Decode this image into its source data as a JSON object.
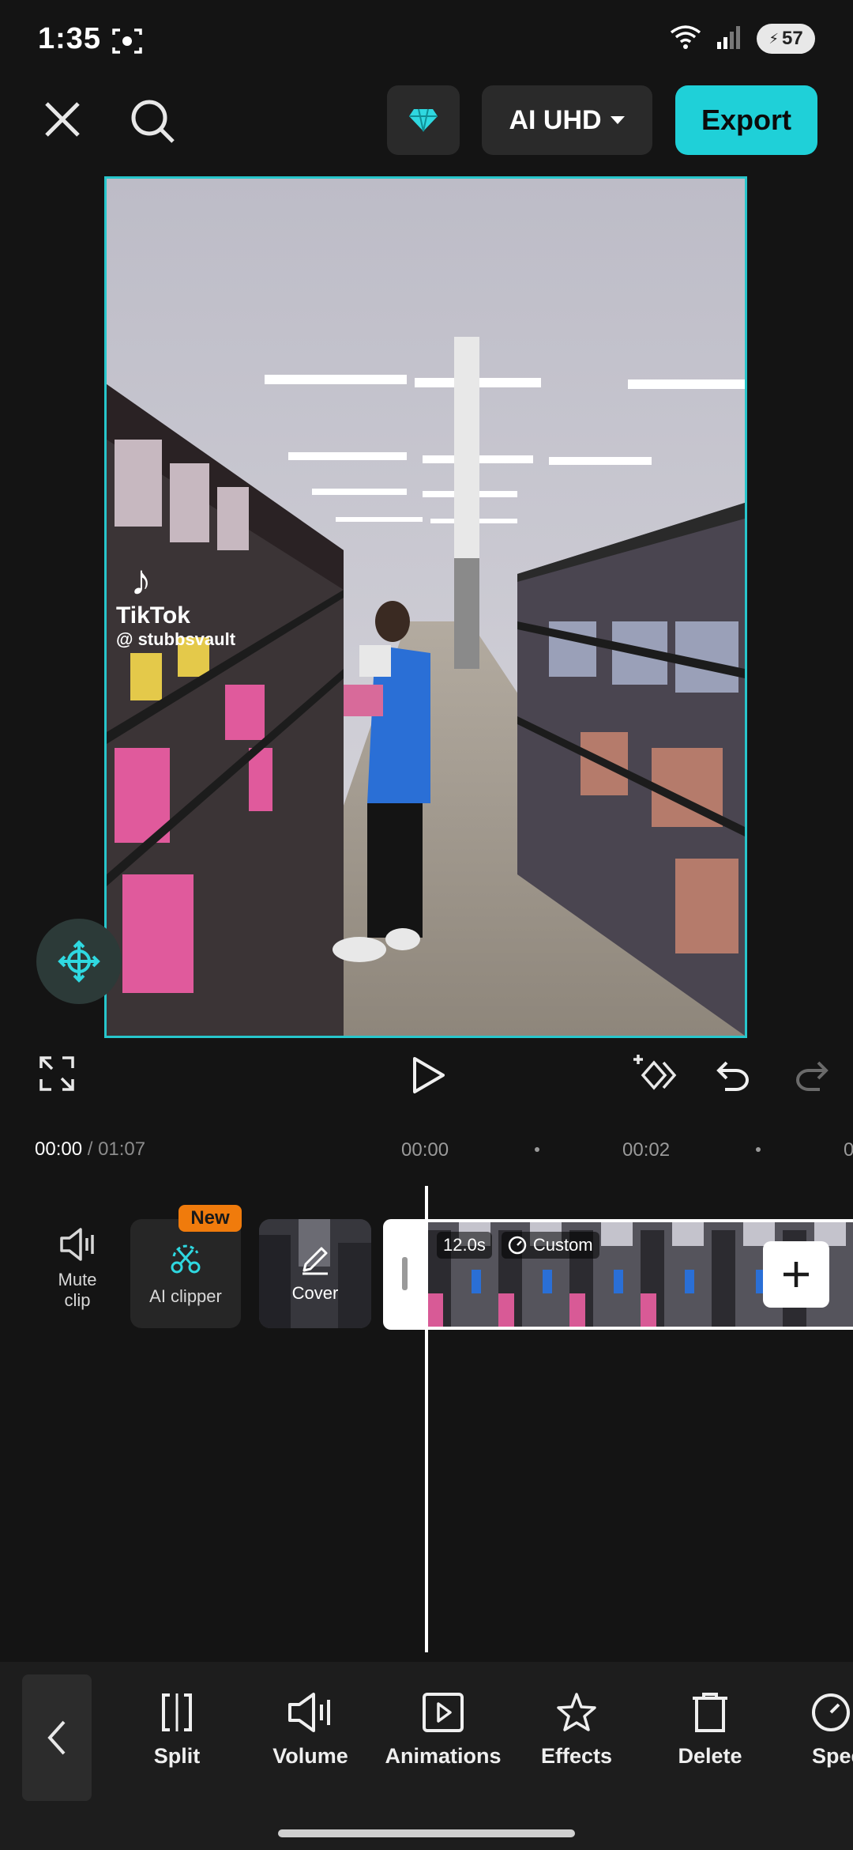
{
  "status": {
    "time": "1:35",
    "battery": "57"
  },
  "topbar": {
    "quality_label": "AI UHD",
    "export_label": "Export"
  },
  "preview": {
    "watermark_brand": "TikTok",
    "watermark_user": "@ stubbsvault"
  },
  "timeline": {
    "current": "00:00",
    "total": "/ 01:07",
    "ticks": [
      "00:00",
      "00:02",
      "0"
    ]
  },
  "track": {
    "mute_label_line1": "Mute",
    "mute_label_line2": "clip",
    "ai_clipper_label": "AI clipper",
    "new_badge": "New",
    "cover_label": "Cover",
    "clip_duration": "12.0s",
    "clip_speed": "Custom"
  },
  "toolbar": {
    "items": [
      {
        "label": "Split"
      },
      {
        "label": "Volume"
      },
      {
        "label": "Animations"
      },
      {
        "label": "Effects"
      },
      {
        "label": "Delete"
      },
      {
        "label": "Spee"
      }
    ]
  },
  "colors": {
    "accent": "#1fd0d8",
    "badge": "#f07b0c",
    "background": "#141414"
  }
}
